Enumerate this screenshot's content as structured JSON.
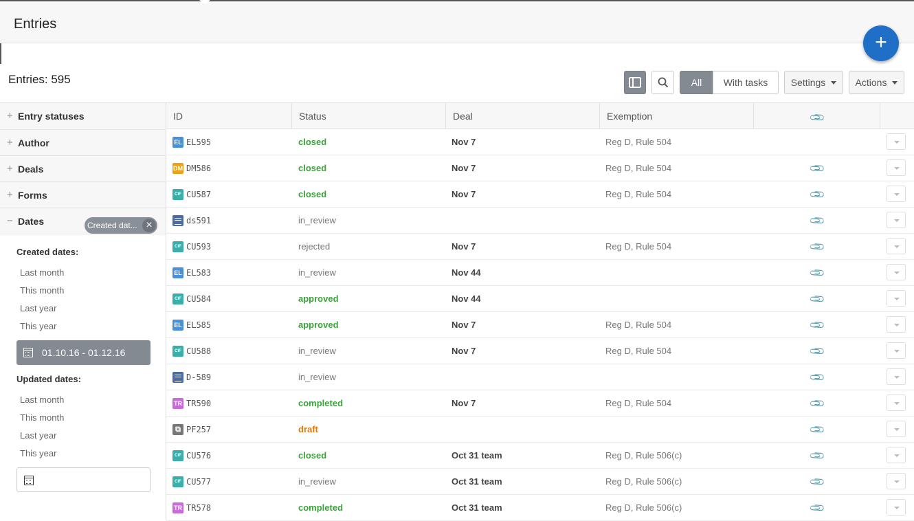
{
  "page": {
    "title": "Entries"
  },
  "fab": {
    "icon": "plus-icon",
    "label": "+"
  },
  "count_label": "Entries: 595",
  "toolbar": {
    "all_label": "All",
    "with_tasks_label": "With tasks",
    "settings_label": "Settings",
    "actions_label": "Actions"
  },
  "sidebar": {
    "filters": [
      {
        "label": "Entry statuses",
        "sign": "+"
      },
      {
        "label": "Author",
        "sign": "+"
      },
      {
        "label": "Deals",
        "sign": "+"
      },
      {
        "label": "Forms",
        "sign": "+"
      },
      {
        "label": "Dates",
        "sign": "−"
      }
    ],
    "date_chip": "Created dat...",
    "created_title": "Created dates:",
    "created_links": [
      "Last month",
      "This month",
      "Last year",
      "This year"
    ],
    "created_range": "01.10.16 - 01.12.16",
    "updated_title": "Updated dates:",
    "updated_links": [
      "Last month",
      "This month",
      "Last year",
      "This year"
    ],
    "updated_range": ""
  },
  "table": {
    "columns": [
      "ID",
      "Status",
      "Deal",
      "Exemption"
    ],
    "rows": [
      {
        "type": "EL",
        "badge": "EL",
        "id": "EL595",
        "status": "closed",
        "status_color": "green",
        "deal": "Nov 7",
        "exemption": "Reg D, Rule 504",
        "attachment": false
      },
      {
        "type": "DM",
        "badge": "DM",
        "id": "DM586",
        "status": "closed",
        "status_color": "green",
        "deal": "Nov 7",
        "exemption": "Reg D, Rule 504",
        "attachment": true
      },
      {
        "type": "CIF",
        "badge": "CIF",
        "id": "CU587",
        "status": "closed",
        "status_color": "green",
        "deal": "Nov 7",
        "exemption": "Reg D, Rule 504",
        "attachment": true
      },
      {
        "type": "DOC",
        "badge": "",
        "id": "ds591",
        "status": "in_review",
        "status_color": "gray",
        "deal": "",
        "exemption": "",
        "attachment": true
      },
      {
        "type": "CIF",
        "badge": "CIF",
        "id": "CU593",
        "status": "rejected",
        "status_color": "gray",
        "deal": "Nov 7",
        "exemption": "Reg D, Rule 504",
        "attachment": true
      },
      {
        "type": "EL",
        "badge": "EL",
        "id": "EL583",
        "status": "in_review",
        "status_color": "gray",
        "deal": "Nov 44",
        "exemption": "",
        "attachment": true
      },
      {
        "type": "CIF",
        "badge": "CIF",
        "id": "CU584",
        "status": "approved",
        "status_color": "green",
        "deal": "Nov 44",
        "exemption": "",
        "attachment": true
      },
      {
        "type": "EL",
        "badge": "EL",
        "id": "EL585",
        "status": "approved",
        "status_color": "green",
        "deal": "Nov 7",
        "exemption": "Reg D, Rule 504",
        "attachment": true
      },
      {
        "type": "CIF",
        "badge": "CIF",
        "id": "CU588",
        "status": "in_review",
        "status_color": "gray",
        "deal": "Nov 7",
        "exemption": "Reg D, Rule 504",
        "attachment": true
      },
      {
        "type": "DOC",
        "badge": "",
        "id": "D-589",
        "status": "in_review",
        "status_color": "gray",
        "deal": "",
        "exemption": "",
        "attachment": true
      },
      {
        "type": "TR",
        "badge": "TR",
        "id": "TR590",
        "status": "completed",
        "status_color": "green",
        "deal": "Nov 7",
        "exemption": "Reg D, Rule 504",
        "attachment": true
      },
      {
        "type": "PF",
        "badge": "⧉",
        "id": "PF257",
        "status": "draft",
        "status_color": "orange",
        "deal": "",
        "exemption": "",
        "attachment": true
      },
      {
        "type": "CIF",
        "badge": "CIF",
        "id": "CU576",
        "status": "closed",
        "status_color": "green",
        "deal": "Oct 31 team",
        "exemption": "Reg D, Rule 506(c)",
        "attachment": true
      },
      {
        "type": "CIF",
        "badge": "CIF",
        "id": "CU577",
        "status": "in_review",
        "status_color": "gray",
        "deal": "Oct 31 team",
        "exemption": "Reg D, Rule 506(c)",
        "attachment": true
      },
      {
        "type": "TR",
        "badge": "TR",
        "id": "TR578",
        "status": "completed",
        "status_color": "green",
        "deal": "Oct 31 team",
        "exemption": "Reg D, Rule 506(c)",
        "attachment": true
      }
    ]
  }
}
